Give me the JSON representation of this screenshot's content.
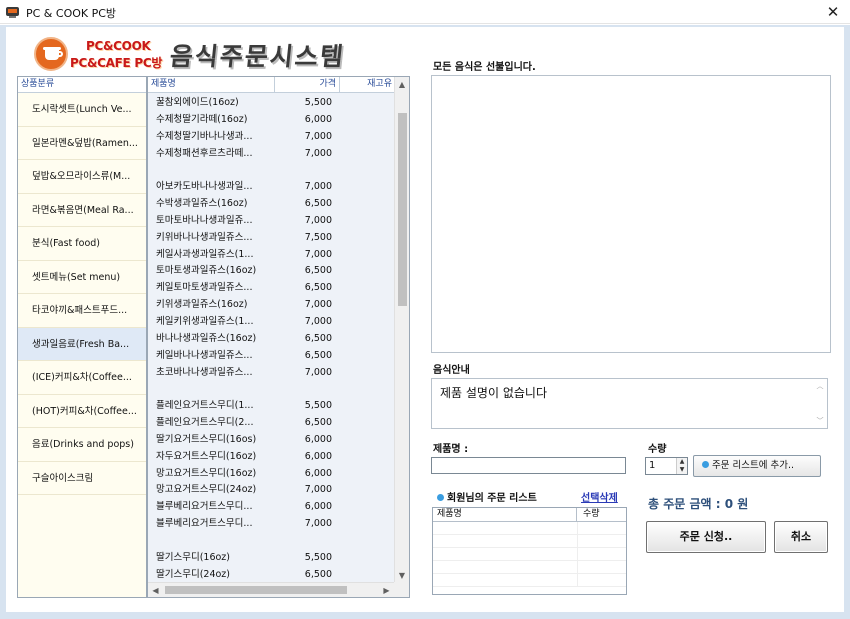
{
  "window": {
    "title": "PC & COOK PC방",
    "close_glyph": "✕"
  },
  "logo": {
    "line1": "PC&COOK",
    "line2": "PC&CAFE PC방",
    "system_title": "음식주문시스템"
  },
  "categories": {
    "header": "상품분류",
    "items": [
      {
        "label": "도시락셋트(Lunch Ve..."
      },
      {
        "label": "일본라멘&덮밥(Ramen..."
      },
      {
        "label": "덮밥&오므라이스류(M..."
      },
      {
        "label": "라면&볶음면(Meal Ra..."
      },
      {
        "label": "분식(Fast food)"
      },
      {
        "label": "셋트메뉴(Set menu)"
      },
      {
        "label": "타코야끼&패스트푸드..."
      },
      {
        "label": "생과일음료(Fresh Ba..."
      },
      {
        "label": "(ICE)커피&차(Coffee..."
      },
      {
        "label": "(HOT)커피&차(Coffee..."
      },
      {
        "label": "음료(Drinks and pops)"
      },
      {
        "label": "구슬아이스크림"
      }
    ],
    "selected_index": 7
  },
  "products": {
    "headers": {
      "name": "제품명",
      "price": "가격",
      "stock": "재고유"
    },
    "rows": [
      {
        "name": "꿀참외에이드(16oz)",
        "price": "5,500"
      },
      {
        "name": "수제청딸기라떼(16oz)",
        "price": "6,000"
      },
      {
        "name": "수제청딸기바나나생과...",
        "price": "7,000"
      },
      {
        "name": "수제청패션후르츠라떼...",
        "price": "7,000"
      },
      {
        "name": "",
        "price": ""
      },
      {
        "name": "아보카도바나나생과일...",
        "price": "7,000"
      },
      {
        "name": "수박생과일쥬스(16oz)",
        "price": "6,500"
      },
      {
        "name": "토마토바나나생과일쥬...",
        "price": "7,000"
      },
      {
        "name": "키위바나나생과일쥬스...",
        "price": "7,500"
      },
      {
        "name": "케일사과생과일쥬스(1...",
        "price": "7,000"
      },
      {
        "name": "토마토생과일쥬스(16oz)",
        "price": "6,500"
      },
      {
        "name": "케일토마토생과일쥬스...",
        "price": "6,500"
      },
      {
        "name": "키위생과일쥬스(16oz)",
        "price": "7,000"
      },
      {
        "name": "케일키위생과일쥬스(1...",
        "price": "7,000"
      },
      {
        "name": "바나나생과일쥬스(16oz)",
        "price": "6,500"
      },
      {
        "name": "케일바나나생과일쥬스...",
        "price": "6,500"
      },
      {
        "name": "초코바나나생과일쥬스...",
        "price": "7,000"
      },
      {
        "name": "",
        "price": ""
      },
      {
        "name": "플레인요거트스무디(1...",
        "price": "5,500"
      },
      {
        "name": "플레인요거트스무디(2...",
        "price": "6,500"
      },
      {
        "name": "딸기요거트스무디(16os)",
        "price": "6,000"
      },
      {
        "name": "자두요거트스무디(16oz)",
        "price": "6,000"
      },
      {
        "name": "망고요거트스무디(16oz)",
        "price": "6,000"
      },
      {
        "name": "망고요거트스무디(24oz)",
        "price": "7,000"
      },
      {
        "name": "블루베리요거트스무디...",
        "price": "6,000"
      },
      {
        "name": "블루베리요거트스무디...",
        "price": "7,000"
      },
      {
        "name": "",
        "price": ""
      },
      {
        "name": "딸기스무디(16oz)",
        "price": "5,500"
      },
      {
        "name": "딸기스무디(24oz)",
        "price": "6,500"
      }
    ]
  },
  "order": {
    "prepaid_notice": "모든 음식은 선불입니다.",
    "info_label": "음식안내",
    "info_text": "제품 설명이 없습니다",
    "product_name_label": "제품명 :",
    "product_name_value": "",
    "qty_label": "수량",
    "qty_value": "1",
    "add_button": "주문 리스트에 추가..",
    "cart_title": "회원님의 주문 리스트",
    "cart_delete": "선택삭제",
    "cart_headers": {
      "name": "제품명",
      "qty": "수량"
    },
    "total_text": "총 주문 금액 : 0 원",
    "submit_button": "주문 신청..",
    "cancel_button": "취소"
  },
  "colors": {
    "accent_blue": "#2d4f9a",
    "logo_red": "#c81818",
    "logo_orange": "#e4681f",
    "frame": "#d7e3f0",
    "selected_row": "#dfe9f6"
  }
}
